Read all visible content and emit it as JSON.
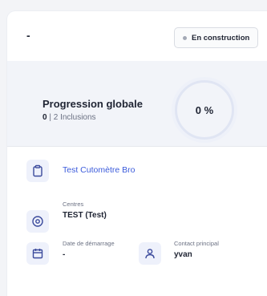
{
  "header": {
    "title": "-",
    "status": "En construction"
  },
  "progress": {
    "title": "Progression globale",
    "count": "0",
    "separator": "|",
    "inclusions": "2 Inclusions",
    "percent": "0 %"
  },
  "details": {
    "study_link": "Test Cutomètre Bro",
    "centres_label": "Centres",
    "centres_value": "TEST (Test)",
    "start_label": "Date de démarrage",
    "start_value": "-",
    "contact_label": "Contact principal",
    "contact_value": "yvan"
  },
  "icons": {
    "study": "clipboard-icon",
    "centres": "target-icon",
    "start": "calendar-icon",
    "contact": "user-icon"
  },
  "colors": {
    "accent": "#3b5bdb",
    "icon_bg": "#eef1fb",
    "progress_bg": "#f2f4f9"
  }
}
